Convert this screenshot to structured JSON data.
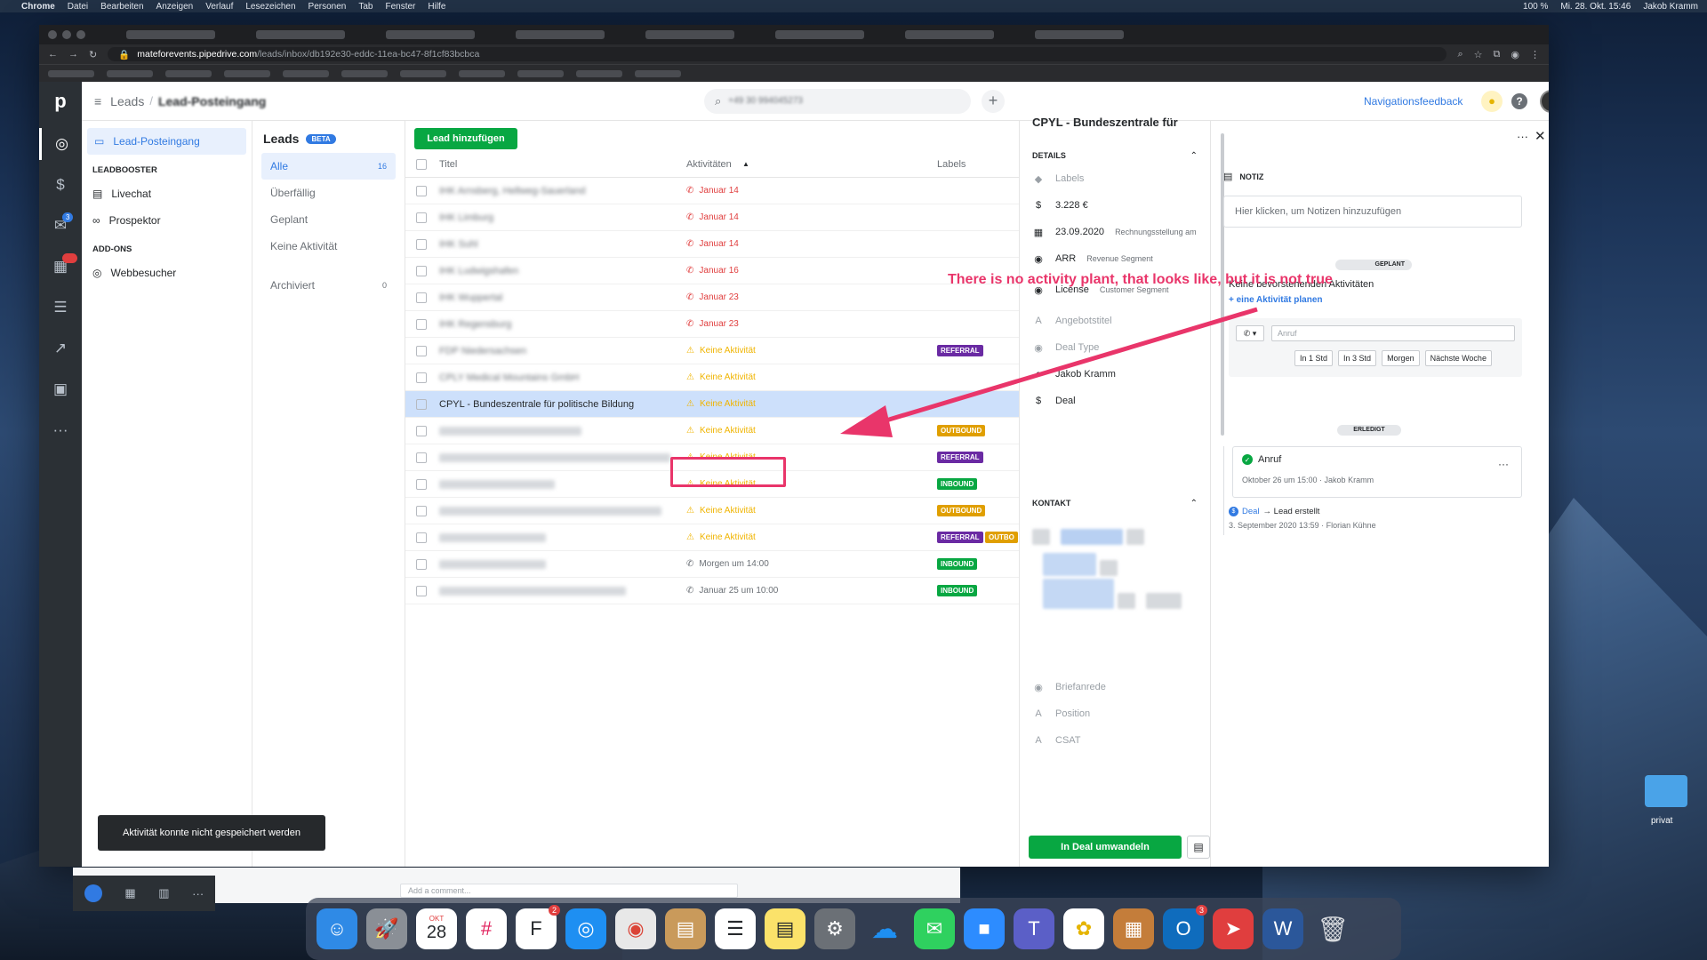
{
  "menubar": {
    "app": "Chrome",
    "items": [
      "Datei",
      "Bearbeiten",
      "Anzeigen",
      "Verlauf",
      "Lesezeichen",
      "Personen",
      "Tab",
      "Fenster",
      "Hilfe"
    ],
    "battery": "100 %",
    "clock": "Mi. 28. Okt. 15:46",
    "user": "Jakob Kramm"
  },
  "browser": {
    "domain": "mateforevents.pipedrive.com",
    "path": "/leads/inbox/db192e30-eddc-11ea-bc47-8f1cf83bcbca"
  },
  "rail": {
    "mail_badge": "3",
    "calendar_badge": "33"
  },
  "topbar": {
    "breadcrumb_root": "Leads",
    "breadcrumb_sep": "/",
    "breadcrumb_current": "Lead-Posteingang",
    "search_value": "+49 30 994045273",
    "feedback": "Navigationsfeedback"
  },
  "sidebar": {
    "inbox": "Lead-Posteingang",
    "leadbooster_head": "LEADBOOSTER",
    "livechat": "Livechat",
    "prospector": "Prospektor",
    "addons_head": "ADD-ONS",
    "webvisitors": "Webbesucher"
  },
  "filters": {
    "title": "Leads",
    "beta": "BETA",
    "items": [
      {
        "label": "Alle",
        "count": "16"
      },
      {
        "label": "Überfällig"
      },
      {
        "label": "Geplant"
      },
      {
        "label": "Keine Aktivität"
      }
    ],
    "archived": {
      "label": "Archiviert",
      "count": "0"
    }
  },
  "list": {
    "add_button": "Lead hinzufügen",
    "columns": [
      "Titel",
      "Aktivitäten",
      "Labels"
    ],
    "rows": [
      {
        "title": "IHK Arnsberg, Hellweg-Sauerland",
        "blur": true,
        "activity": "Januar 14",
        "kind": "overdue"
      },
      {
        "title": "IHK Limburg",
        "blur": true,
        "activity": "Januar 14",
        "kind": "overdue"
      },
      {
        "title": "IHK Suhl",
        "blur": true,
        "activity": "Januar 14",
        "kind": "overdue"
      },
      {
        "title": "IHK Ludwigshafen",
        "blur": true,
        "activity": "Januar 16",
        "kind": "overdue"
      },
      {
        "title": "IHK Wuppertal",
        "blur": true,
        "activity": "Januar 23",
        "kind": "overdue"
      },
      {
        "title": "IHK Regensburg",
        "blur": true,
        "activity": "Januar 23",
        "kind": "overdue"
      },
      {
        "title": "FDP Niedersachsen",
        "blur": true,
        "activity": "Keine Aktivität",
        "kind": "none",
        "labels": [
          "REFERRAL"
        ]
      },
      {
        "title": "CPLY Medical Mountains GmbH",
        "blur": true,
        "activity": "Keine Aktivität",
        "kind": "none"
      },
      {
        "title": "CPYL - Bundeszentrale für politische Bildung",
        "blur": false,
        "activity": "Keine Aktivität",
        "kind": "none",
        "selected": true
      },
      {
        "title": "",
        "blur": true,
        "activity": "Keine Aktivität",
        "kind": "none",
        "labels": [
          "OUTBOUND"
        ]
      },
      {
        "title": "",
        "blur": true,
        "activity": "Keine Aktivität",
        "kind": "none",
        "labels": [
          "REFERRAL"
        ]
      },
      {
        "title": "",
        "blur": true,
        "activity": "Keine Aktivität",
        "kind": "none",
        "labels": [
          "INBOUND"
        ]
      },
      {
        "title": "",
        "blur": true,
        "activity": "Keine Aktivität",
        "kind": "none",
        "labels": [
          "OUTBOUND"
        ]
      },
      {
        "title": "",
        "blur": true,
        "activity": "Keine Aktivität",
        "kind": "none",
        "labels": [
          "REFERRAL",
          "OUTBO"
        ]
      },
      {
        "title": "",
        "blur": true,
        "activity": "Morgen um 14:00",
        "kind": "planned",
        "labels": [
          "INBOUND"
        ]
      },
      {
        "title": "",
        "blur": true,
        "activity": "Januar 25 um 10:00",
        "kind": "planned",
        "labels": [
          "INBOUND"
        ]
      }
    ]
  },
  "detail": {
    "title": "CPYL - Bundeszentrale für",
    "section_details": "DETAILS",
    "section_contact": "KONTAKT",
    "fields": [
      {
        "icon": "tag-icon",
        "glyph": "◆",
        "value": "Labels",
        "muted": true
      },
      {
        "icon": "dollar-icon",
        "glyph": "$",
        "value": "3.228 €"
      },
      {
        "icon": "calendar-field-icon",
        "glyph": "▦",
        "value": "23.09.2020",
        "sub": "Rechnungsstellung am"
      },
      {
        "icon": "radio-icon",
        "glyph": "◉",
        "value": "ARR",
        "sub": "Revenue Segment"
      },
      {
        "icon": "radio-icon",
        "glyph": "◉",
        "value": "License",
        "sub": "Customer Segment"
      },
      {
        "icon": "text-icon",
        "glyph": "A",
        "value": "Angebotstitel",
        "muted": true
      },
      {
        "icon": "radio-icon",
        "glyph": "◉",
        "value": "Deal Type",
        "muted": true
      },
      {
        "icon": "person-icon",
        "glyph": "●",
        "value": "Jakob Kramm"
      },
      {
        "icon": "deal-field-icon",
        "glyph": "$",
        "value": "Deal"
      }
    ],
    "lower_fields": [
      {
        "icon": "radio-icon",
        "glyph": "◉",
        "value": "Briefanrede",
        "muted": true
      },
      {
        "icon": "text-icon",
        "glyph": "A",
        "value": "Position",
        "muted": true
      },
      {
        "icon": "text-icon",
        "glyph": "A",
        "value": "CSAT",
        "muted": true
      }
    ],
    "convert": "In Deal umwandeln"
  },
  "note": {
    "section": "NOTIZ",
    "placeholder": "Hier klicken, um Notizen hinzuzufügen",
    "planned": "GEPLANT",
    "no_activities": "Keine bevorstehenden Aktivitäten",
    "plan_link": "+ eine Aktivität planen",
    "call_placeholder": "Anruf",
    "quick": [
      "In 1 Std",
      "In 3 Std",
      "Morgen",
      "Nächste Woche"
    ],
    "done": "ERLEDIGT",
    "done_title": "Anruf",
    "done_meta": "Oktober 26 um 15:00 · Jakob Kramm",
    "log_deal": "Deal",
    "log_text": "→ Lead erstellt",
    "log_meta": "3. September 2020 13:59 · Florian Kühne"
  },
  "toast": "Aktivität konnte nicht gespeichert werden",
  "annotation": "There is no activity plant, that looks like, but it is not true",
  "comment_placeholder": "Add a comment...",
  "desktop_folder": "privat",
  "dock": {
    "cal_month": "OKT",
    "cal_day": "28",
    "badge_f": "2",
    "badge_o": "3"
  },
  "colors": {
    "accent": "#317ae2",
    "green": "#08a742",
    "overdue": "#e03e3e",
    "warning": "#f0b400",
    "annotation": "#e9356a"
  }
}
